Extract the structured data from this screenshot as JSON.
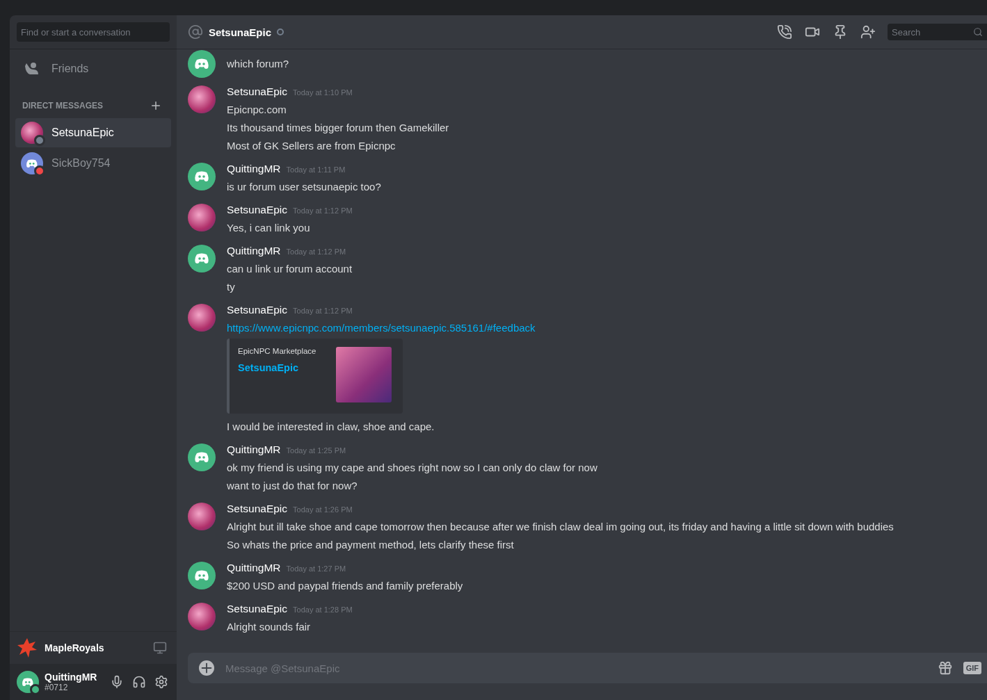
{
  "sidebar": {
    "search": {
      "placeholder": "Find or start a conversation"
    },
    "friends": "Friends",
    "dm_heading": "DIRECT MESSAGES",
    "dms": [
      {
        "name": "SetsunaEpic",
        "kind": "photo",
        "selected": true,
        "color": "#747f8d"
      },
      {
        "name": "SickBoy754",
        "kind": "discord",
        "selected": false,
        "color": "#f04747"
      }
    ],
    "activity": {
      "name": "MapleRoyals"
    },
    "user": {
      "name": "QuittingMR",
      "tag": "#0712"
    }
  },
  "header": {
    "name": "SetsunaEpic",
    "search": {
      "placeholder": "Search"
    }
  },
  "partial_message": {
    "text": "which forum?"
  },
  "messages": [
    {
      "author": "SetsunaEpic",
      "kind": "photo",
      "time": "Today at 1:10 PM",
      "lines": [
        "Epicnpc.com",
        "Its thousand times bigger forum then Gamekiller",
        "Most of GK Sellers are from Epicnpc"
      ]
    },
    {
      "author": "QuittingMR",
      "kind": "discord",
      "time": "Today at 1:11 PM",
      "lines": [
        "is ur forum user setsunaepic too?"
      ]
    },
    {
      "author": "SetsunaEpic",
      "kind": "photo",
      "time": "Today at 1:12 PM",
      "lines": [
        "Yes, i can link you"
      ]
    },
    {
      "author": "QuittingMR",
      "kind": "discord",
      "time": "Today at 1:12 PM",
      "lines": [
        "can u link ur forum account",
        "ty"
      ]
    },
    {
      "author": "SetsunaEpic",
      "kind": "photo",
      "time": "Today at 1:12 PM",
      "link": "https://www.epicnpc.com/members/setsunaepic.585161/#feedback",
      "embed": {
        "provider": "EpicNPC Marketplace",
        "title": "SetsunaEpic"
      },
      "lines": [
        "I would be interested in claw, shoe and cape."
      ]
    },
    {
      "author": "QuittingMR",
      "kind": "discord",
      "time": "Today at 1:25 PM",
      "lines": [
        "ok my friend is using my cape and shoes right now so I can only do claw for now",
        "want to just do that for now?"
      ]
    },
    {
      "author": "SetsunaEpic",
      "kind": "photo",
      "time": "Today at 1:26 PM",
      "lines": [
        "Alright but ill take shoe and cape tomorrow then because after we finish claw deal im going out, its friday and having a little sit down with buddies",
        "So whats the price and payment method, lets clarify these first"
      ]
    },
    {
      "author": "QuittingMR",
      "kind": "discord",
      "time": "Today at 1:27 PM",
      "lines": [
        "$200 USD and paypal friends and family preferably"
      ]
    },
    {
      "author": "SetsunaEpic",
      "kind": "photo",
      "time": "Today at 1:28 PM",
      "lines": [
        "Alright sounds fair"
      ]
    }
  ],
  "composer": {
    "placeholder": "Message @SetsunaEpic",
    "gif": "GIF"
  }
}
